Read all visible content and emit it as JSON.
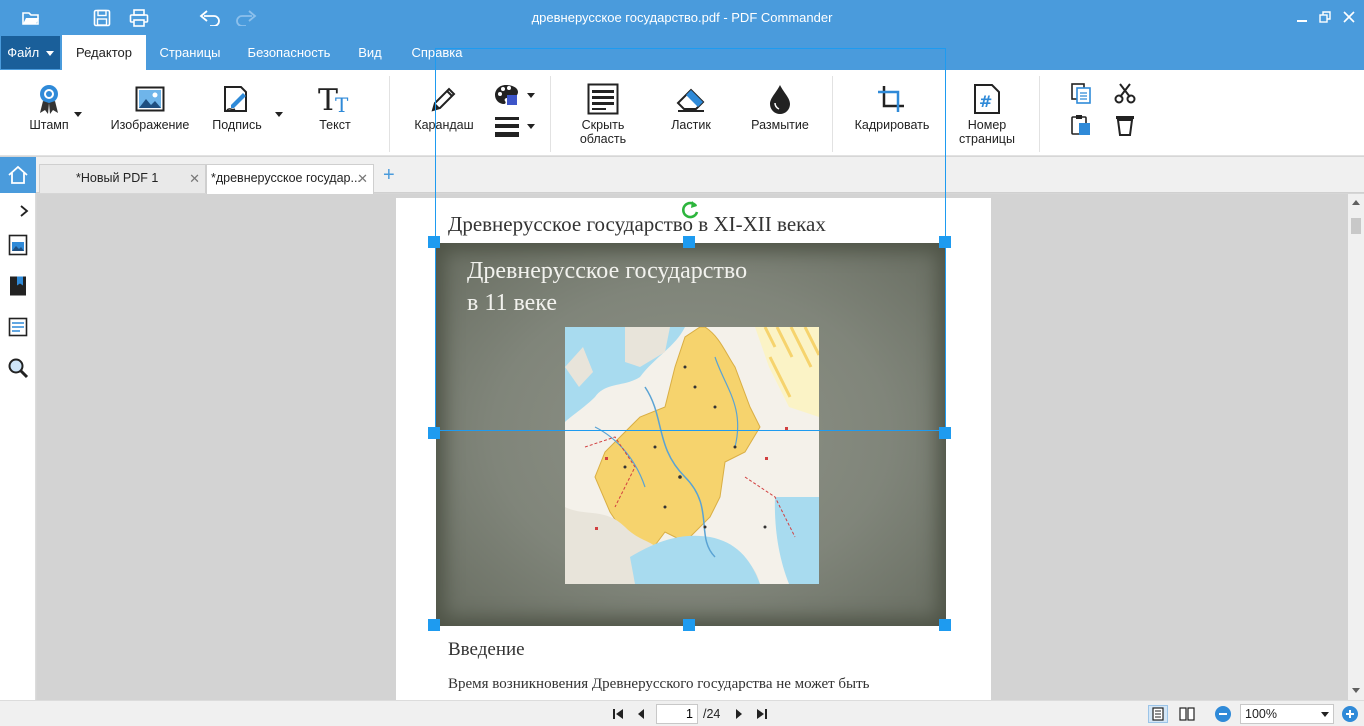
{
  "window": {
    "title": "древнерусское государство.pdf - PDF Commander"
  },
  "menu": {
    "file_label": "Файл",
    "tabs": [
      "Редактор",
      "Страницы",
      "Безопасность",
      "Вид",
      "Справка"
    ]
  },
  "ribbon": {
    "stamp": "Штамп",
    "image": "Изображение",
    "signature": "Подпись",
    "text": "Текст",
    "pencil": "Карандаш",
    "hide_area_1": "Скрыть",
    "hide_area_2": "область",
    "eraser": "Ластик",
    "blur": "Размытие",
    "crop": "Кадрировать",
    "page_number_1": "Номер",
    "page_number_2": "страницы"
  },
  "doc_tabs": [
    {
      "label": "*Новый PDF 1"
    },
    {
      "label": "*древнерусское государ..."
    }
  ],
  "page": {
    "heading": "Древнерусское государство в XI-XII веках",
    "slide_title_1": "Древнерусское государство",
    "slide_title_2": "в 11 веке",
    "intro_heading": "Введение",
    "intro_text": "Время возникновения Древнерусского государства не может быть"
  },
  "status": {
    "current_page": "1",
    "total_pages": "/24",
    "zoom": "100%"
  },
  "colors": {
    "accent": "#4a9bdc",
    "selection": "#1e9bf0",
    "file_button": "#1a5f9a"
  }
}
